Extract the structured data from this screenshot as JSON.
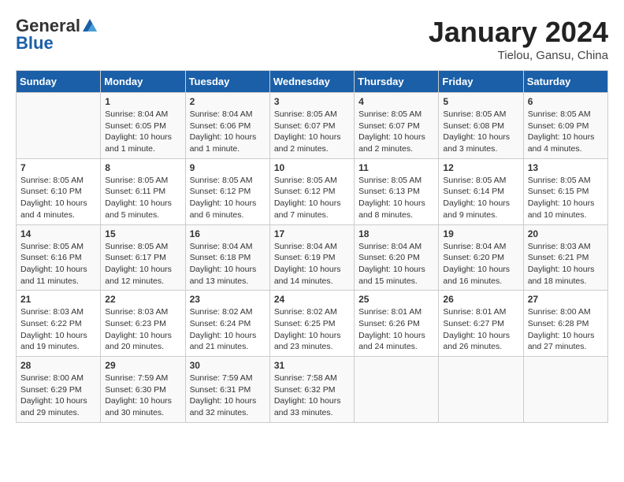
{
  "logo": {
    "general": "General",
    "blue": "Blue"
  },
  "title": "January 2024",
  "location": "Tielou, Gansu, China",
  "days_header": [
    "Sunday",
    "Monday",
    "Tuesday",
    "Wednesday",
    "Thursday",
    "Friday",
    "Saturday"
  ],
  "weeks": [
    [
      {
        "day": "",
        "info": ""
      },
      {
        "day": "1",
        "info": "Sunrise: 8:04 AM\nSunset: 6:05 PM\nDaylight: 10 hours\nand 1 minute."
      },
      {
        "day": "2",
        "info": "Sunrise: 8:04 AM\nSunset: 6:06 PM\nDaylight: 10 hours\nand 1 minute."
      },
      {
        "day": "3",
        "info": "Sunrise: 8:05 AM\nSunset: 6:07 PM\nDaylight: 10 hours\nand 2 minutes."
      },
      {
        "day": "4",
        "info": "Sunrise: 8:05 AM\nSunset: 6:07 PM\nDaylight: 10 hours\nand 2 minutes."
      },
      {
        "day": "5",
        "info": "Sunrise: 8:05 AM\nSunset: 6:08 PM\nDaylight: 10 hours\nand 3 minutes."
      },
      {
        "day": "6",
        "info": "Sunrise: 8:05 AM\nSunset: 6:09 PM\nDaylight: 10 hours\nand 4 minutes."
      }
    ],
    [
      {
        "day": "7",
        "info": "Sunrise: 8:05 AM\nSunset: 6:10 PM\nDaylight: 10 hours\nand 4 minutes."
      },
      {
        "day": "8",
        "info": "Sunrise: 8:05 AM\nSunset: 6:11 PM\nDaylight: 10 hours\nand 5 minutes."
      },
      {
        "day": "9",
        "info": "Sunrise: 8:05 AM\nSunset: 6:12 PM\nDaylight: 10 hours\nand 6 minutes."
      },
      {
        "day": "10",
        "info": "Sunrise: 8:05 AM\nSunset: 6:12 PM\nDaylight: 10 hours\nand 7 minutes."
      },
      {
        "day": "11",
        "info": "Sunrise: 8:05 AM\nSunset: 6:13 PM\nDaylight: 10 hours\nand 8 minutes."
      },
      {
        "day": "12",
        "info": "Sunrise: 8:05 AM\nSunset: 6:14 PM\nDaylight: 10 hours\nand 9 minutes."
      },
      {
        "day": "13",
        "info": "Sunrise: 8:05 AM\nSunset: 6:15 PM\nDaylight: 10 hours\nand 10 minutes."
      }
    ],
    [
      {
        "day": "14",
        "info": "Sunrise: 8:05 AM\nSunset: 6:16 PM\nDaylight: 10 hours\nand 11 minutes."
      },
      {
        "day": "15",
        "info": "Sunrise: 8:05 AM\nSunset: 6:17 PM\nDaylight: 10 hours\nand 12 minutes."
      },
      {
        "day": "16",
        "info": "Sunrise: 8:04 AM\nSunset: 6:18 PM\nDaylight: 10 hours\nand 13 minutes."
      },
      {
        "day": "17",
        "info": "Sunrise: 8:04 AM\nSunset: 6:19 PM\nDaylight: 10 hours\nand 14 minutes."
      },
      {
        "day": "18",
        "info": "Sunrise: 8:04 AM\nSunset: 6:20 PM\nDaylight: 10 hours\nand 15 minutes."
      },
      {
        "day": "19",
        "info": "Sunrise: 8:04 AM\nSunset: 6:20 PM\nDaylight: 10 hours\nand 16 minutes."
      },
      {
        "day": "20",
        "info": "Sunrise: 8:03 AM\nSunset: 6:21 PM\nDaylight: 10 hours\nand 18 minutes."
      }
    ],
    [
      {
        "day": "21",
        "info": "Sunrise: 8:03 AM\nSunset: 6:22 PM\nDaylight: 10 hours\nand 19 minutes."
      },
      {
        "day": "22",
        "info": "Sunrise: 8:03 AM\nSunset: 6:23 PM\nDaylight: 10 hours\nand 20 minutes."
      },
      {
        "day": "23",
        "info": "Sunrise: 8:02 AM\nSunset: 6:24 PM\nDaylight: 10 hours\nand 21 minutes."
      },
      {
        "day": "24",
        "info": "Sunrise: 8:02 AM\nSunset: 6:25 PM\nDaylight: 10 hours\nand 23 minutes."
      },
      {
        "day": "25",
        "info": "Sunrise: 8:01 AM\nSunset: 6:26 PM\nDaylight: 10 hours\nand 24 minutes."
      },
      {
        "day": "26",
        "info": "Sunrise: 8:01 AM\nSunset: 6:27 PM\nDaylight: 10 hours\nand 26 minutes."
      },
      {
        "day": "27",
        "info": "Sunrise: 8:00 AM\nSunset: 6:28 PM\nDaylight: 10 hours\nand 27 minutes."
      }
    ],
    [
      {
        "day": "28",
        "info": "Sunrise: 8:00 AM\nSunset: 6:29 PM\nDaylight: 10 hours\nand 29 minutes."
      },
      {
        "day": "29",
        "info": "Sunrise: 7:59 AM\nSunset: 6:30 PM\nDaylight: 10 hours\nand 30 minutes."
      },
      {
        "day": "30",
        "info": "Sunrise: 7:59 AM\nSunset: 6:31 PM\nDaylight: 10 hours\nand 32 minutes."
      },
      {
        "day": "31",
        "info": "Sunrise: 7:58 AM\nSunset: 6:32 PM\nDaylight: 10 hours\nand 33 minutes."
      },
      {
        "day": "",
        "info": ""
      },
      {
        "day": "",
        "info": ""
      },
      {
        "day": "",
        "info": ""
      }
    ]
  ]
}
